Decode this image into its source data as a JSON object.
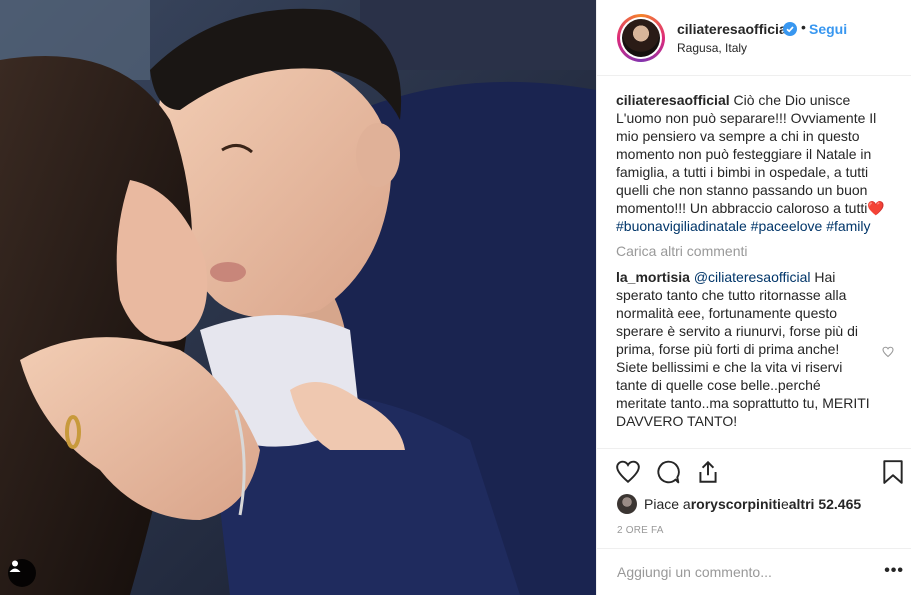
{
  "post": {
    "username": "ciliateresaofficial",
    "follow_label": "Segui",
    "location": "Ragusa, Italy",
    "caption": {
      "author": "ciliateresaofficial",
      "text": " Ciò che Dio unisce L'uomo non può separare!!! Ovviamente Il mio pensiero va sempre a chi in questo momento non può festeggiare il Natale in famiglia, a tutti i bimbi in ospedale, a tutti quelli che non stanno passando un buon momento!!! Un abbraccio caloroso a tutti",
      "emoji": "❤️",
      "hashtags": [
        "#buonavigiliadinatale",
        "#paceelove",
        "#family"
      ]
    },
    "load_more": "Carica altri commenti",
    "comment": {
      "author": "la_mortisia",
      "mention": "@ciliateresaofficial",
      "text": " Hai sperato tanto che tutto ritornasse alla normalità eee, fortunamente questo sperare è servito a riunurvi, forse più di prima, forse più forti di prima anche! Siete bellissimi e che la vita vi riservi tante di quelle cose belle..perché meritate tanto..ma soprattutto tu, MERITI DAVVERO TANTO!"
    },
    "likes": {
      "prefix": "Piace a ",
      "user": "roryscorpiniti",
      "middle": " e ",
      "count": "altri 52.465"
    },
    "time": "2 ORE FA",
    "add_comment_placeholder": "Aggiungi un commento...",
    "more_options": "•••"
  },
  "colors": {
    "follow": "#3897f0",
    "hashtag": "#003569",
    "muted": "#999999",
    "verified": "#3897f0"
  },
  "icons": [
    "heart-icon",
    "comment-icon",
    "share-icon",
    "bookmark-icon",
    "verified-icon",
    "user-tag-icon"
  ]
}
